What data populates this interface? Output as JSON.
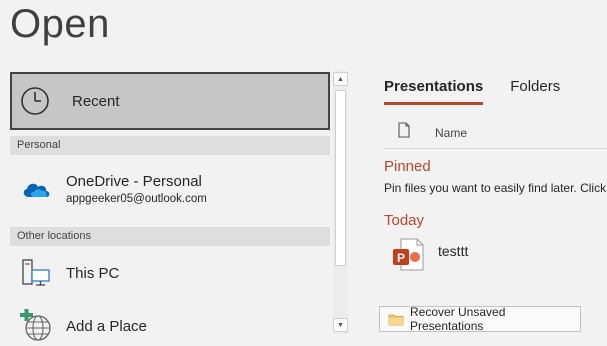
{
  "header": {
    "title": "Open"
  },
  "locations": {
    "recent": {
      "label": "Recent"
    },
    "sections": {
      "personal": "Personal",
      "other": "Other locations"
    },
    "onedrive": {
      "name": "OneDrive - Personal",
      "email": "appgeeker05@outlook.com"
    },
    "this_pc": {
      "label": "This PC"
    },
    "add_place": {
      "label": "Add a Place"
    }
  },
  "main": {
    "tabs": [
      {
        "label": "Presentations",
        "active": true
      },
      {
        "label": "Folders",
        "active": false
      }
    ],
    "column_header": "Name",
    "groups": {
      "pinned": "Pinned",
      "pinned_hint": "Pin files you want to easily find later. Click",
      "today": "Today"
    },
    "files": [
      {
        "name": "testtt",
        "icon": "powerpoint-file-icon"
      }
    ],
    "recover_button": "Recover Unsaved Presentations"
  },
  "colors": {
    "accent": "#b7472a",
    "selected_bg": "#c6c6c6",
    "onedrive_blue": "#0364b8"
  }
}
